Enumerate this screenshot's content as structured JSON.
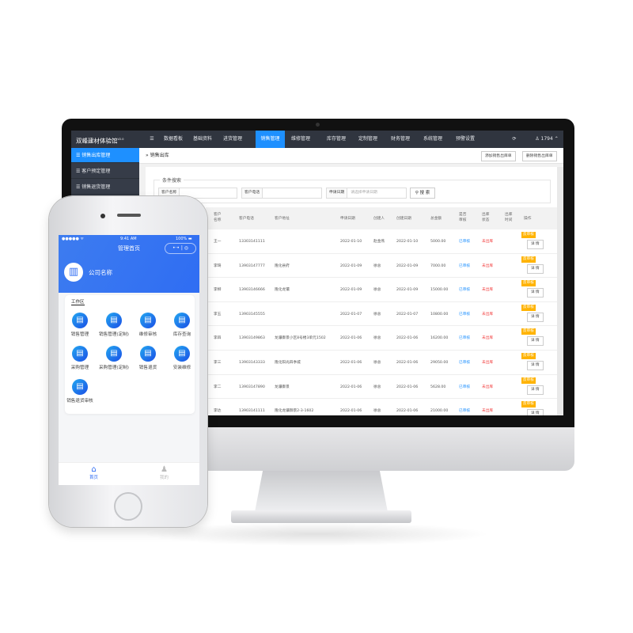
{
  "web": {
    "brand": "双峰建材体验馆",
    "version": "V2.0",
    "nav": [
      {
        "label": "☰",
        "icon": "menu-icon"
      },
      {
        "label": "数据看板"
      },
      {
        "label": "基础资料"
      },
      {
        "label": "进货管理"
      },
      {
        "label": "销售管理",
        "active": true
      },
      {
        "label": "维修管理"
      },
      {
        "label": "库存管理"
      },
      {
        "label": "定制管理"
      },
      {
        "label": "财务管理"
      },
      {
        "label": "系统管理"
      },
      {
        "label": "预警设置"
      }
    ],
    "refresh_icon": "refresh-icon",
    "user": "1794",
    "sidebar": [
      {
        "label": "☰ 销售出库管理",
        "active": true
      },
      {
        "label": "☰ 客户预定管理"
      },
      {
        "label": "☰ 销售退货管理"
      }
    ],
    "breadcrumb": "销售出库",
    "buttons": {
      "add": "添加销售出库单",
      "delete": "删除销售出库单"
    },
    "search": {
      "legend": "条件搜索",
      "name_label": "客户名称",
      "phone_label": "客户电话",
      "date_label": "申请日期",
      "date_placeholder": "请选择申请日期",
      "button": "搜 索"
    },
    "columns": [
      "客户名称",
      "客户电话",
      "客户地址",
      "申请日期",
      "创建人",
      "创建日期",
      "总金额",
      "是否审核",
      "出库状态",
      "出库时间",
      "操作"
    ],
    "rows": [
      [
        "王一",
        "13303141111",
        "",
        "2022-01-10",
        "赵金燕",
        "2022-01-10",
        "5000.00",
        "已审核",
        "未出库",
        ""
      ],
      [
        "李琦",
        "13903147777",
        "隆化县府",
        "2022-01-09",
        "徐总",
        "2022-01-09",
        "7000.00",
        "已审核",
        "未出库",
        ""
      ],
      [
        "李柳",
        "13903146666",
        "隆化龙镶",
        "2022-01-09",
        "徐总",
        "2022-01-09",
        "15000.00",
        "已审核",
        "未出库",
        ""
      ],
      [
        "李五",
        "13903145555",
        "",
        "2022-01-07",
        "徐总",
        "2022-01-07",
        "10800.00",
        "已审核",
        "未出库",
        ""
      ],
      [
        "李四",
        "13903149863",
        "龙骧御景小区8号楼3单元1502",
        "2022-01-06",
        "徐总",
        "2022-01-06",
        "16200.00",
        "已审核",
        "未出库",
        ""
      ],
      [
        "李三",
        "13903143333",
        "隆化阳光四季城",
        "2022-01-06",
        "徐总",
        "2022-01-06",
        "29050.00",
        "已审核",
        "未出库",
        ""
      ],
      [
        "李二",
        "13903147890",
        "龙骧御景",
        "2022-01-06",
        "徐总",
        "2022-01-06",
        "5628.00",
        "已审核",
        "未出库",
        ""
      ],
      [
        "李达",
        "13903141111",
        "隆化龙骧御景2-3-1602",
        "2022-01-06",
        "徐总",
        "2022-01-06",
        "21000.00",
        "已审核",
        "未出库",
        ""
      ]
    ],
    "row_actions": {
      "unaudit": "反审核",
      "detail": "详 情"
    }
  },
  "phone": {
    "status": {
      "signal": "●●●●● ᯤ",
      "time": "9:41 AM",
      "battery": "100% ▬"
    },
    "title": "管理首页",
    "capsule": "•·• | ◎",
    "company": "公司名称",
    "section": "工作区",
    "tiles": [
      {
        "label": "销售管理",
        "icon": "document-icon"
      },
      {
        "label": "销售管理(定制)",
        "icon": "edit-document-icon"
      },
      {
        "label": "维修审核",
        "icon": "search-document-icon"
      },
      {
        "label": "库存查询",
        "icon": "box-icon"
      },
      {
        "label": "采购管理",
        "icon": "purchase-icon"
      },
      {
        "label": "采购管理(定制)",
        "icon": "purchase-custom-icon"
      },
      {
        "label": "销售退货",
        "icon": "return-icon"
      },
      {
        "label": "安装维修",
        "icon": "worker-icon"
      },
      {
        "label": "销售退货审核",
        "icon": "return-audit-icon"
      }
    ],
    "tabs": [
      {
        "label": "首页",
        "icon": "home-icon",
        "active": true
      },
      {
        "label": "我的",
        "icon": "user-icon"
      }
    ]
  },
  "colors": {
    "accent": "#1e90ff",
    "nav": "#30353f",
    "badge": "#ffb300",
    "status_red": "#f23b3b",
    "phone_blue": "#2f6df3"
  }
}
